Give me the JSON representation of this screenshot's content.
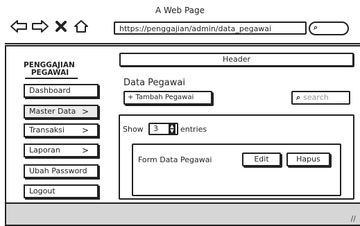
{
  "browser": {
    "title": "A Web Page",
    "url": "https://penggajian/admin/data_pegawai"
  },
  "sidebar": {
    "title_line1": "PENGGAJIAN",
    "title_line2": "PEGAWAI",
    "items": [
      {
        "label": "Dashboard",
        "chevron": ""
      },
      {
        "label": "Master Data",
        "chevron": ">"
      },
      {
        "label": "Transaksi",
        "chevron": ">"
      },
      {
        "label": "Laporan",
        "chevron": ">"
      },
      {
        "label": "Ubah Password",
        "chevron": ""
      },
      {
        "label": "Logout",
        "chevron": ""
      }
    ]
  },
  "header": {
    "label": "Header"
  },
  "content": {
    "title": "Data Pegawai",
    "add_label": "+ Tambah Pegawai",
    "search_placeholder": "search",
    "show_label": "Show",
    "entries_value": "3",
    "entries_label": "entries",
    "row_label": "Form Data Pegawai",
    "edit_label": "Edit",
    "delete_label": "Hapus"
  },
  "icons": {
    "back": "arrow-left-icon",
    "forward": "arrow-right-icon",
    "close": "close-icon",
    "home": "home-icon",
    "search": "search-icon"
  }
}
